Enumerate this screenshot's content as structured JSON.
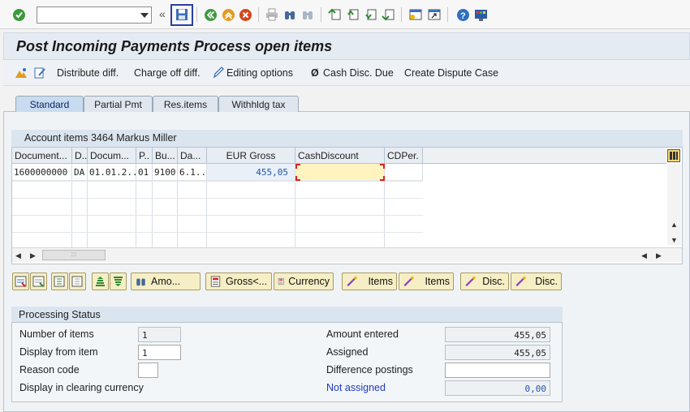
{
  "toolbar": {
    "command_field_value": "",
    "icons": [
      "enter-icon",
      "save-icon",
      "back-icon",
      "exit-icon",
      "cancel-icon",
      "print-icon",
      "find-icon",
      "find-next-icon",
      "first-page-icon",
      "previous-page-icon",
      "next-page-icon",
      "last-page-icon",
      "create-session-icon",
      "shortcut-icon",
      "help-icon",
      "customize-layout-icon"
    ],
    "overflow_chevron": "«"
  },
  "header": {
    "title": "Post Incoming Payments Process open items"
  },
  "app_toolbar": {
    "distribute": "Distribute diff.",
    "charge_off": "Charge off diff.",
    "editing": "Editing options",
    "cash_disc_symbol": "Ø",
    "cash_disc": "Cash Disc. Due",
    "dispute": "Create Dispute Case"
  },
  "tabs": [
    {
      "label": "Standard"
    },
    {
      "label": "Partial Pmt"
    },
    {
      "label": "Res.items"
    },
    {
      "label": "Withhldg tax"
    }
  ],
  "grid": {
    "title": "Account items 3464 Markus Miller",
    "columns": [
      "Document...",
      "D..",
      "Docum...",
      "P..",
      "Bu...",
      "Da...",
      "EUR Gross",
      "CashDiscount",
      "CDPer."
    ],
    "rows": [
      [
        "1600000000",
        "DA",
        "01.01.2...",
        "01",
        "9100",
        "6.1...",
        "455,05",
        "",
        ""
      ]
    ]
  },
  "grid_toolbar": {
    "amount_label": "Amo...",
    "gross_label": "Gross<...",
    "currency_label": "Currency",
    "items1_label": "Items",
    "items2_label": "Items",
    "disc1_label": "Disc.",
    "disc2_label": "Disc."
  },
  "processing_status": {
    "title": "Processing Status",
    "number_of_items_label": "Number of items",
    "number_of_items": "1",
    "display_from_label": "Display from item",
    "display_from": "1",
    "reason_code_label": "Reason code",
    "reason_code": "",
    "display_clearing_label": "Display in clearing currency",
    "amount_entered_label": "Amount entered",
    "amount_entered": "455,05",
    "assigned_label": "Assigned",
    "assigned": "455,05",
    "difference_label": "Difference postings",
    "difference": "",
    "not_assigned_label": "Not assigned",
    "not_assigned": "0,00"
  },
  "colors": {
    "accent": "#2c3e9e",
    "link": "#1f3bbf",
    "amount_blue": "#2255aa",
    "highlight_cell": "#fff3c0"
  }
}
